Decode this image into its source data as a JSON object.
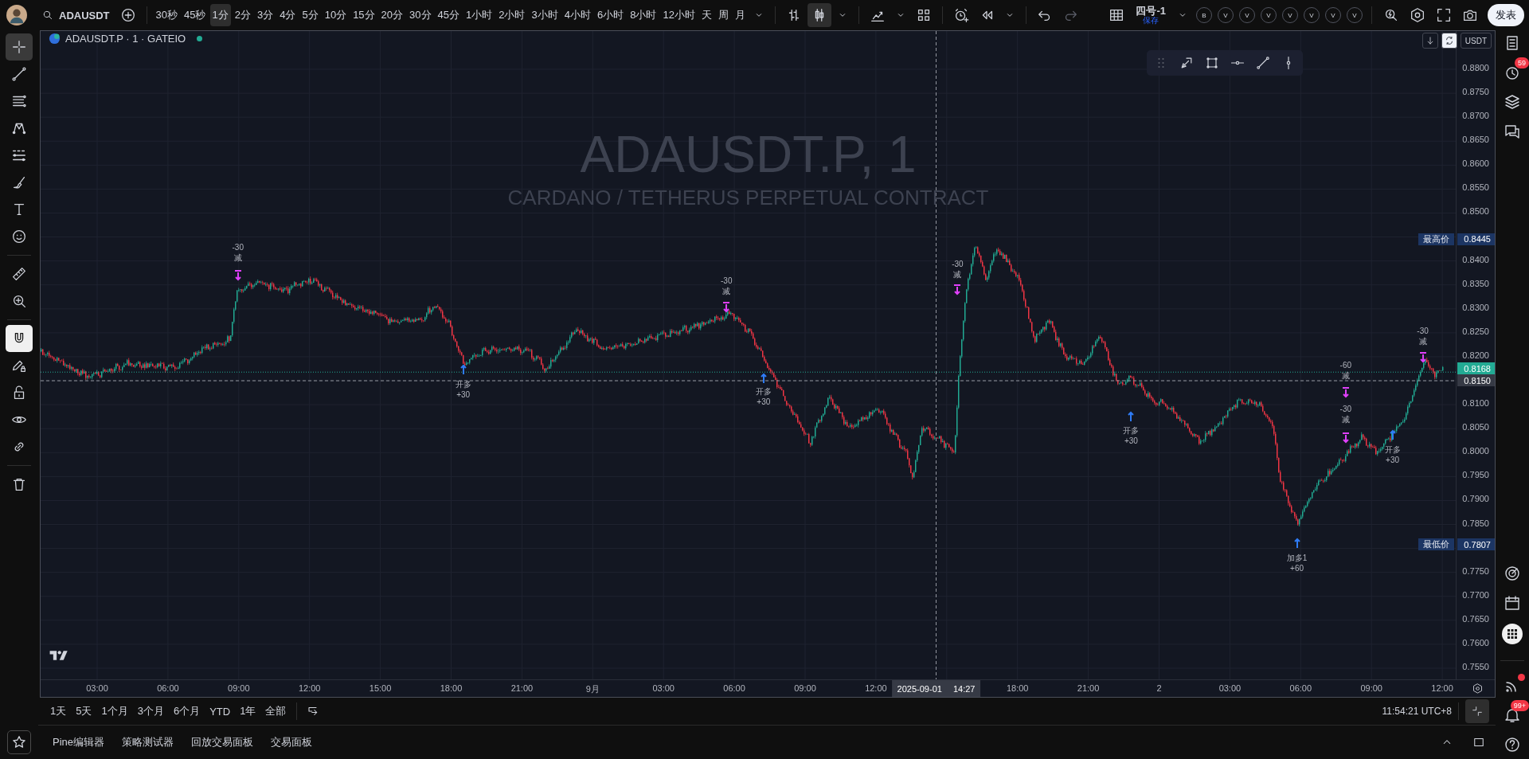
{
  "toolbar": {
    "symbol": "ADAUSDT",
    "intervals": [
      {
        "label": "30秒",
        "selected": false
      },
      {
        "label": "45秒",
        "selected": false
      },
      {
        "label": "1分",
        "selected": true
      },
      {
        "label": "2分",
        "selected": false
      },
      {
        "label": "3分",
        "selected": false
      },
      {
        "label": "4分",
        "selected": false
      },
      {
        "label": "5分",
        "selected": false
      },
      {
        "label": "10分",
        "selected": false
      },
      {
        "label": "15分",
        "selected": false
      },
      {
        "label": "20分",
        "selected": false
      },
      {
        "label": "30分",
        "selected": false
      },
      {
        "label": "45分",
        "selected": false
      },
      {
        "label": "1小时",
        "selected": false
      },
      {
        "label": "2小时",
        "selected": false
      },
      {
        "label": "3小时",
        "selected": false
      },
      {
        "label": "4小时",
        "selected": false
      },
      {
        "label": "6小时",
        "selected": false
      },
      {
        "label": "8小时",
        "selected": false
      },
      {
        "label": "12小时",
        "selected": false
      },
      {
        "label": "天",
        "selected": false
      },
      {
        "label": "周",
        "selected": false
      },
      {
        "label": "月",
        "selected": false
      }
    ],
    "chart_types": [
      {
        "kind": "bars",
        "selected": false
      },
      {
        "kind": "candles",
        "selected": true
      }
    ],
    "layout_name": "四号-1",
    "layout_status": "保存",
    "accounts": [
      "B",
      "V",
      "V",
      "V",
      "V",
      "V",
      "V",
      "V"
    ],
    "publish": "发表"
  },
  "left_toolbar": {
    "tools": [
      {
        "kind": "crosshair",
        "selected": true
      },
      {
        "kind": "trend_line",
        "selected": false
      },
      {
        "kind": "fib",
        "selected": false
      },
      {
        "kind": "pattern",
        "selected": false
      },
      {
        "kind": "prediction",
        "selected": false
      },
      {
        "kind": "brush",
        "selected": false
      },
      {
        "kind": "text",
        "selected": false
      },
      {
        "kind": "emoji",
        "selected": false
      }
    ],
    "magnet_on": true
  },
  "chart": {
    "title": "ADAUSDT.P · 1 · GATEIO",
    "market_open": true,
    "auto_scale": true,
    "currency": "USDT",
    "watermark": "ADAUSDT.P, 1",
    "watermark_subtitle": "CARDANO / TETHERUS PERPETUAL CONTRACT",
    "price_ticks": [
      "0.8800",
      "0.8750",
      "0.8700",
      "0.8650",
      "0.8600",
      "0.8550",
      "0.8500",
      "0.8400",
      "0.8350",
      "0.8300",
      "0.8250",
      "0.8200",
      "0.8100",
      "0.8050",
      "0.8000",
      "0.7950",
      "0.7900",
      "0.7850",
      "0.7750",
      "0.7700",
      "0.7650",
      "0.7600",
      "0.7550"
    ],
    "price_labels": [
      {
        "kind": "high",
        "tag": "最高价",
        "value": "0.8445"
      },
      {
        "kind": "last",
        "value": "0.8168"
      },
      {
        "kind": "crosshair",
        "value": "0.8150"
      },
      {
        "kind": "low",
        "tag": "最低价",
        "value": "0.7807"
      }
    ],
    "time_ticks": [
      "03:00",
      "06:00",
      "09:00",
      "12:00",
      "15:00",
      "18:00",
      "21:00",
      "9月",
      "03:00",
      "06:00",
      "09:00",
      "12:00",
      "18:00",
      "21:00",
      "2",
      "03:00",
      "06:00",
      "09:00",
      "12:00"
    ],
    "crosshair_date": "2025-09-01",
    "crosshair_time": "14:27",
    "markers": [
      {
        "kind": "short",
        "lines": [
          "-30",
          "减"
        ]
      },
      {
        "kind": "long",
        "lines": [
          "开多",
          "+30"
        ]
      },
      {
        "kind": "short",
        "lines": [
          "-30",
          "减"
        ]
      },
      {
        "kind": "long",
        "lines": [
          "开多",
          "+30"
        ]
      },
      {
        "kind": "short",
        "lines": [
          "-30",
          "减"
        ]
      },
      {
        "kind": "long",
        "lines": [
          "开多",
          "+30"
        ]
      },
      {
        "kind": "long",
        "lines": [
          "加多1",
          "+60"
        ]
      },
      {
        "kind": "short",
        "lines": [
          "-60",
          "减"
        ]
      },
      {
        "kind": "short",
        "lines": [
          "-30",
          "减"
        ]
      },
      {
        "kind": "long",
        "lines": [
          "开多",
          "+30"
        ]
      },
      {
        "kind": "short",
        "lines": [
          "-30",
          "减"
        ]
      }
    ]
  },
  "range_bar": {
    "ranges": [
      "1天",
      "5天",
      "1个月",
      "3个月",
      "6个月",
      "YTD",
      "1年",
      "全部"
    ],
    "clock": "11:54:21 UTC+8"
  },
  "panel_tabs": [
    "Pine编辑器",
    "策略测试器",
    "回放交易面板",
    "交易面板"
  ],
  "right_sidebar": {
    "alerts_badge": "59",
    "notifications_badge": "99+",
    "feed_unread": true
  }
}
